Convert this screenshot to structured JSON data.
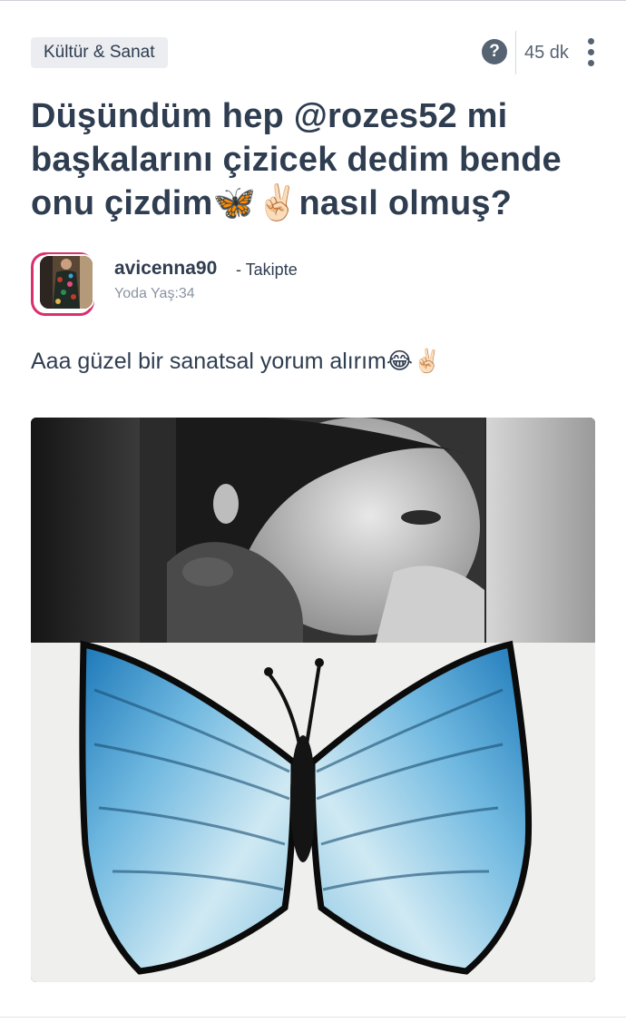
{
  "header": {
    "category": "Kültür & Sanat",
    "help_glyph": "?",
    "time_ago": "45 dk"
  },
  "post": {
    "title": "Düşündüm hep @rozes52 mi başkalarını çizicek dedim bende onu çizdim🦋✌🏻nasıl olmuş?",
    "body": "Aaa güzel bir sanatsal yorum alırım😂✌🏻"
  },
  "author": {
    "username": "avicenna90",
    "follow_status": "- Takipte",
    "meta": "Yoda Yaş:34"
  },
  "icons": {
    "help": "question-circle-icon",
    "more": "more-vertical-icon"
  },
  "colors": {
    "accent": "#d8316b",
    "text": "#2f3d50",
    "muted": "#8a94a3",
    "chip": "#ebedf0"
  }
}
